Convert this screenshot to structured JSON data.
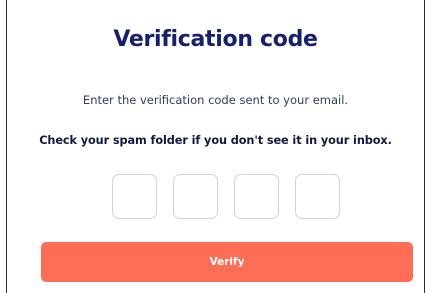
{
  "dialog": {
    "title": "Verification code",
    "description": "Enter the verification code sent to your email.",
    "spam_notice": "Check your spam folder if you don't see it in your inbox.",
    "code_inputs": [
      {
        "value": "",
        "placeholder": ""
      },
      {
        "value": "",
        "placeholder": ""
      },
      {
        "value": "",
        "placeholder": ""
      },
      {
        "value": "",
        "placeholder": ""
      }
    ],
    "verify_label": "Verify"
  },
  "colors": {
    "title": "#16206b",
    "accent_button": "#fe6e56",
    "input_border": "#cfd3da"
  }
}
